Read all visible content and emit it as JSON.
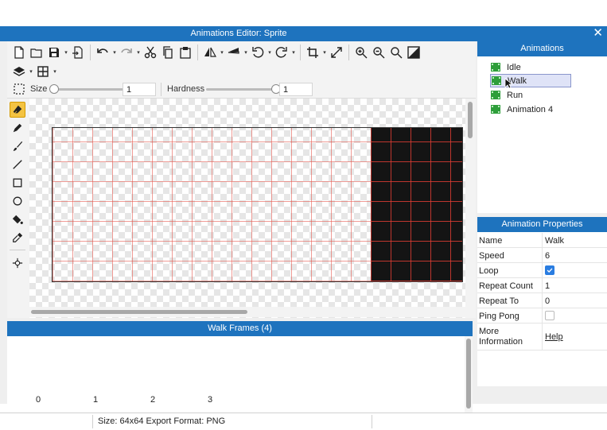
{
  "window": {
    "title": "Animations Editor: Sprite",
    "close_glyph": "✕"
  },
  "toolbar": {
    "icons": [
      "new-file-icon",
      "open-folder-icon",
      "save-icon",
      "export-icon",
      "undo-icon",
      "redo-icon",
      "cut-icon",
      "copy-icon",
      "paste-icon",
      "flip-horizontal-icon",
      "flip-vertical-icon",
      "rotate-left-icon",
      "rotate-right-icon",
      "crop-icon",
      "fit-icon",
      "zoom-in-icon",
      "zoom-out-icon",
      "zoom-reset-icon",
      "toggle-bg-icon"
    ]
  },
  "brush": {
    "size_label": "Size",
    "size_value": "1",
    "hardness_label": "Hardness",
    "hardness_value": "1"
  },
  "frames": {
    "title": "Walk Frames (4)",
    "indices": [
      "0",
      "1",
      "2",
      "3"
    ]
  },
  "status": {
    "text": "Size: 64x64   Export Format: PNG"
  },
  "animations": {
    "title": "Animations",
    "items": [
      {
        "label": "Idle",
        "selected": false
      },
      {
        "label": "Walk",
        "selected": true
      },
      {
        "label": "Run",
        "selected": false
      },
      {
        "label": "Animation 4",
        "selected": false
      }
    ]
  },
  "properties": {
    "title": "Animation Properties",
    "rows": [
      {
        "key": "Name",
        "value": "Walk"
      },
      {
        "key": "Speed",
        "value": "6"
      },
      {
        "key": "Loop",
        "value": "checked"
      },
      {
        "key": "Repeat Count",
        "value": "1"
      },
      {
        "key": "Repeat To",
        "value": "0"
      },
      {
        "key": "Ping Pong",
        "value": "unchecked"
      }
    ],
    "more_info_label_line1": "More",
    "more_info_label_line2": "Information",
    "help_link": "Help"
  },
  "colors": {
    "accent": "#1e73be",
    "selected_tool": "#f4c342",
    "film_icon": "#2e9e3a"
  }
}
